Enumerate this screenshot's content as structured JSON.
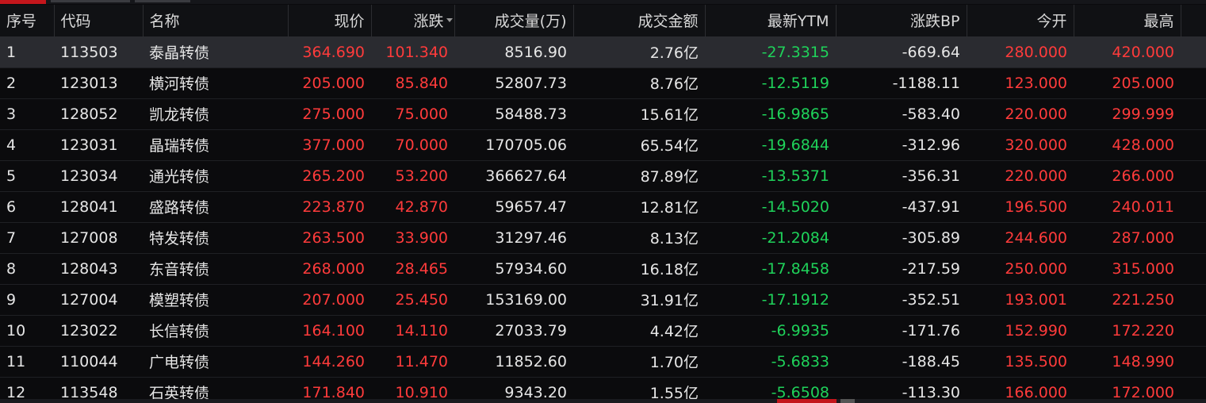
{
  "table": {
    "headers": [
      "序号",
      "代码",
      "名称",
      "现价",
      "涨跌",
      "成交量(万)",
      "成交金额",
      "最新YTM",
      "涨跌BP",
      "今开",
      "最高"
    ],
    "rows": [
      [
        "1",
        "113503",
        "泰晶转债",
        "364.690",
        "101.340",
        "8516.90",
        "2.76亿",
        "-27.3315",
        "-669.64",
        "280.000",
        "420.000"
      ],
      [
        "2",
        "123013",
        "横河转债",
        "205.000",
        "85.840",
        "52807.73",
        "8.76亿",
        "-12.5119",
        "-1188.11",
        "123.000",
        "205.000"
      ],
      [
        "3",
        "128052",
        "凯龙转债",
        "275.000",
        "75.000",
        "58488.73",
        "15.61亿",
        "-16.9865",
        "-583.40",
        "220.000",
        "299.999"
      ],
      [
        "4",
        "123031",
        "晶瑞转债",
        "377.000",
        "70.000",
        "170705.06",
        "65.54亿",
        "-19.6844",
        "-312.96",
        "320.000",
        "428.000"
      ],
      [
        "5",
        "123034",
        "通光转债",
        "265.200",
        "53.200",
        "366627.64",
        "87.89亿",
        "-13.5371",
        "-356.31",
        "220.000",
        "266.000"
      ],
      [
        "6",
        "128041",
        "盛路转债",
        "223.870",
        "42.870",
        "59657.47",
        "12.81亿",
        "-14.5020",
        "-437.91",
        "196.500",
        "240.011"
      ],
      [
        "7",
        "127008",
        "特发转债",
        "263.500",
        "33.900",
        "31297.46",
        "8.13亿",
        "-21.2084",
        "-305.89",
        "244.600",
        "287.000"
      ],
      [
        "8",
        "128043",
        "东音转债",
        "268.000",
        "28.465",
        "57934.60",
        "16.18亿",
        "-17.8458",
        "-217.59",
        "250.000",
        "315.000"
      ],
      [
        "9",
        "127004",
        "模塑转债",
        "207.000",
        "25.450",
        "153169.00",
        "31.91亿",
        "-17.1912",
        "-352.51",
        "193.001",
        "221.250"
      ],
      [
        "10",
        "123022",
        "长信转债",
        "164.100",
        "14.110",
        "27033.79",
        "4.42亿",
        "-6.9935",
        "-171.76",
        "152.990",
        "172.220"
      ],
      [
        "11",
        "110044",
        "广电转债",
        "144.260",
        "11.470",
        "11852.60",
        "1.70亿",
        "-5.6833",
        "-188.45",
        "135.500",
        "148.990"
      ],
      [
        "12",
        "113548",
        "石英转债",
        "171.840",
        "10.910",
        "9343.20",
        "1.55亿",
        "-5.6508",
        "-113.30",
        "166.000",
        "172.000"
      ]
    ],
    "selected_row": 0,
    "sort_column": 4
  },
  "colors": {
    "up": "#ff3b3b",
    "down": "#1fd25a",
    "neutral": "#e6e6e6",
    "accent_tab": "#c4161c",
    "background": "#0b0b0d"
  }
}
